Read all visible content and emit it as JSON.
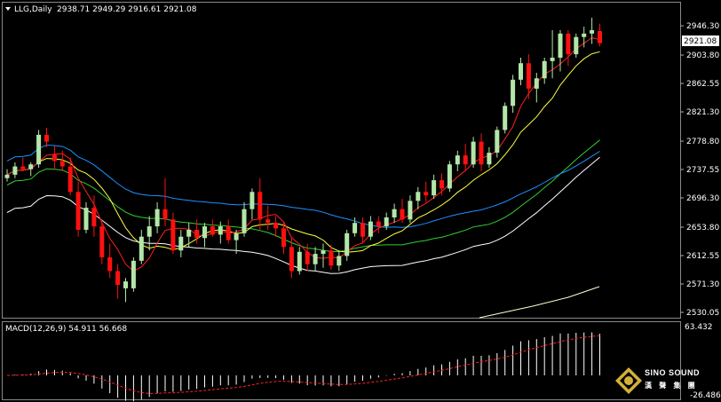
{
  "header": {
    "title": "LLG,Daily",
    "ohlc": "2938.71 2949.29 2916.61 2921.08"
  },
  "current_price": "2921.08",
  "price_axis": {
    "ticks": [
      "2946.30",
      "2903.80",
      "2862.55",
      "2821.30",
      "2778.80",
      "2737.55",
      "2696.30",
      "2653.80",
      "2612.55",
      "2571.30",
      "2530.05"
    ]
  },
  "macd": {
    "label": "MACD(12,26,9) 54.911 56.668",
    "axis_top": "63.432",
    "axis_bottom": "-26.486"
  },
  "logo": {
    "line1": "SINO SOUND",
    "line2": "漢 聲 集 團"
  },
  "colors": {
    "up": "#b3e6a8",
    "down": "#ff1010",
    "ma5": "#ff2020",
    "ma10": "#ffff40",
    "ma30": "#32cd32",
    "ma60": "#1e90ff",
    "ma120": "#ffffff",
    "ma250": "#ffffd0"
  },
  "chart_data": {
    "type": "candlestick",
    "ylim": [
      2530.05,
      2958
    ],
    "candles": [
      [
        2725,
        2738,
        2720,
        2730
      ],
      [
        2730,
        2748,
        2725,
        2742
      ],
      [
        2742,
        2755,
        2735,
        2738
      ],
      [
        2738,
        2748,
        2728,
        2745
      ],
      [
        2745,
        2795,
        2740,
        2788
      ],
      [
        2788,
        2798,
        2770,
        2778
      ],
      [
        2760,
        2772,
        2738,
        2750
      ],
      [
        2750,
        2765,
        2735,
        2742
      ],
      [
        2742,
        2755,
        2700,
        2705
      ],
      [
        2705,
        2720,
        2640,
        2650
      ],
      [
        2650,
        2690,
        2645,
        2682
      ],
      [
        2682,
        2700,
        2640,
        2655
      ],
      [
        2655,
        2665,
        2600,
        2610
      ],
      [
        2610,
        2630,
        2580,
        2590
      ],
      [
        2590,
        2600,
        2550,
        2570
      ],
      [
        2565,
        2580,
        2545,
        2575
      ],
      [
        2565,
        2610,
        2560,
        2605
      ],
      [
        2605,
        2650,
        2600,
        2640
      ],
      [
        2640,
        2670,
        2620,
        2655
      ],
      [
        2655,
        2690,
        2645,
        2680
      ],
      [
        2680,
        2725,
        2655,
        2665
      ],
      [
        2665,
        2675,
        2615,
        2620
      ],
      [
        2620,
        2650,
        2610,
        2640
      ],
      [
        2640,
        2660,
        2625,
        2650
      ],
      [
        2650,
        2665,
        2630,
        2638
      ],
      [
        2638,
        2660,
        2625,
        2655
      ],
      [
        2655,
        2665,
        2640,
        2643
      ],
      [
        2643,
        2662,
        2630,
        2655
      ],
      [
        2655,
        2665,
        2630,
        2635
      ],
      [
        2635,
        2650,
        2615,
        2645
      ],
      [
        2645,
        2690,
        2640,
        2680
      ],
      [
        2680,
        2710,
        2665,
        2705
      ],
      [
        2705,
        2725,
        2650,
        2665
      ],
      [
        2665,
        2685,
        2650,
        2660
      ],
      [
        2660,
        2670,
        2640,
        2652
      ],
      [
        2652,
        2660,
        2615,
        2625
      ],
      [
        2625,
        2640,
        2580,
        2590
      ],
      [
        2590,
        2625,
        2585,
        2618
      ],
      [
        2618,
        2630,
        2590,
        2600
      ],
      [
        2600,
        2625,
        2590,
        2615
      ],
      [
        2615,
        2630,
        2595,
        2620
      ],
      [
        2620,
        2628,
        2592,
        2598
      ],
      [
        2598,
        2620,
        2590,
        2612
      ],
      [
        2612,
        2650,
        2605,
        2645
      ],
      [
        2645,
        2668,
        2640,
        2660
      ],
      [
        2660,
        2668,
        2630,
        2640
      ],
      [
        2640,
        2670,
        2635,
        2662
      ],
      [
        2662,
        2670,
        2645,
        2655
      ],
      [
        2655,
        2675,
        2650,
        2668
      ],
      [
        2668,
        2688,
        2660,
        2680
      ],
      [
        2680,
        2695,
        2660,
        2665
      ],
      [
        2665,
        2700,
        2660,
        2692
      ],
      [
        2692,
        2712,
        2680,
        2705
      ],
      [
        2705,
        2720,
        2690,
        2700
      ],
      [
        2700,
        2730,
        2695,
        2722
      ],
      [
        2722,
        2732,
        2700,
        2710
      ],
      [
        2710,
        2750,
        2705,
        2745
      ],
      [
        2745,
        2765,
        2735,
        2758
      ],
      [
        2758,
        2775,
        2735,
        2745
      ],
      [
        2745,
        2785,
        2740,
        2778
      ],
      [
        2778,
        2790,
        2735,
        2745
      ],
      [
        2745,
        2770,
        2740,
        2762
      ],
      [
        2762,
        2800,
        2755,
        2795
      ],
      [
        2795,
        2835,
        2790,
        2830
      ],
      [
        2830,
        2875,
        2820,
        2868
      ],
      [
        2868,
        2900,
        2860,
        2892
      ],
      [
        2892,
        2905,
        2840,
        2855
      ],
      [
        2855,
        2878,
        2835,
        2870
      ],
      [
        2870,
        2900,
        2862,
        2895
      ],
      [
        2895,
        2940,
        2870,
        2900
      ],
      [
        2900,
        2940,
        2880,
        2935
      ],
      [
        2935,
        2940,
        2888,
        2905
      ],
      [
        2905,
        2935,
        2900,
        2930
      ],
      [
        2930,
        2945,
        2915,
        2935
      ],
      [
        2935,
        2958,
        2920,
        2940
      ],
      [
        2938.71,
        2949.29,
        2916.61,
        2921.08
      ]
    ]
  }
}
